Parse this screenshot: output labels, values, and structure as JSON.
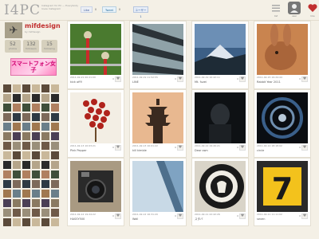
{
  "header": {
    "logo": "I4PC",
    "tagline": "Instagram for PC — Everybody loves Instagram",
    "like_label": "Like",
    "like_count": "0",
    "tweet_label": "Tweet",
    "tweet_count": "0",
    "hatena_label": "ユーザー 1",
    "nav": [
      {
        "label": "list",
        "icon": "list-icon"
      },
      {
        "label": "user",
        "icon": "user-icon"
      },
      {
        "label": "like",
        "icon": "heart-icon"
      }
    ]
  },
  "profile": {
    "username": "mifdesign",
    "sub": "by mifdesign",
    "avatar_icon": "airplane-icon",
    "stats": [
      {
        "num": "52",
        "label": "photos"
      },
      {
        "num": "132",
        "label": "followers"
      },
      {
        "num": "15",
        "label": "following"
      }
    ]
  },
  "banner": {
    "text": "スマートフォン女子"
  },
  "photos": [
    {
      "time": "2011-02-21 00:21:00",
      "title": "kick off!!",
      "count": "0"
    },
    {
      "time": "2011-02-19 11:52:55",
      "title": "LINE",
      "count": "0"
    },
    {
      "time": "2011-02-19 10:42:11",
      "title": "Mt. fuzei",
      "count": "0"
    },
    {
      "time": "2011-02-15 19:24:44",
      "title": "Rabbit Year 2011",
      "count": "0"
    },
    {
      "time": "2011-02-13 10:03:21",
      "title": "Pink Pepper",
      "count": "0"
    },
    {
      "time": "2011-02-13 10:01:22",
      "title": "kill kimble",
      "count": "0"
    },
    {
      "time": "2011-02-12 19:20:21",
      "title": "Dear own",
      "count": "0"
    },
    {
      "time": "2011-02-12 18:18:02",
      "title": "circle",
      "count": "0"
    },
    {
      "time": "2011-02-12 19:24:22",
      "title": "HASSY500",
      "count": "0"
    },
    {
      "time": "2011-02-12 16:31:20",
      "title": "Wall",
      "count": "0"
    },
    {
      "time": "2011-02-11 22:42:26",
      "title": "スタバ",
      "count": "0"
    },
    {
      "time": "2011-02-11 11:11:02",
      "title": "seven",
      "count": "0"
    }
  ],
  "colors": {
    "background": "#f4f0e6",
    "accent": "#c12f2f"
  }
}
